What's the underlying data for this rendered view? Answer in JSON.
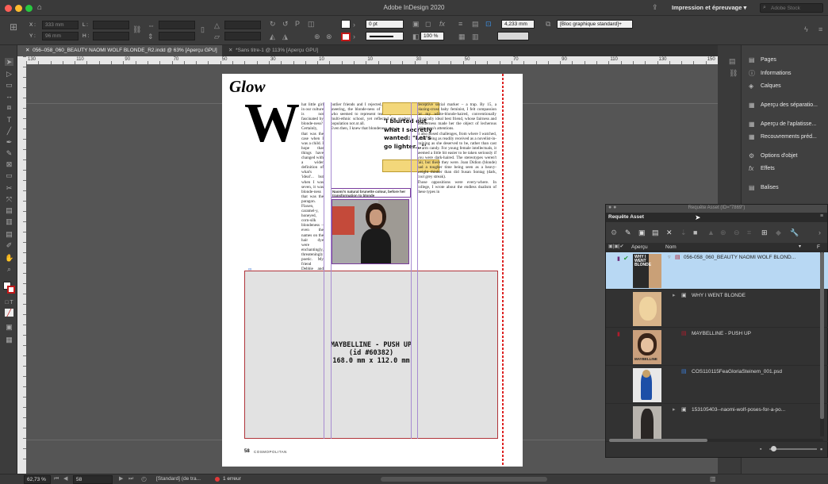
{
  "window": {
    "title": "Adobe InDesign 2020",
    "workspace": "Impression et épreuvage",
    "search_placeholder": "Adobe Stock"
  },
  "control": {
    "x_label": "X :",
    "y_label": "Y :",
    "w_label": "L :",
    "h_label": "H :",
    "x_value": "333 mm",
    "y_value": "96 mm",
    "stroke_weight": "0 pt",
    "scale": "100 %",
    "width_value": "4,233 mm",
    "object_style": "[Bloc graphique standard]+"
  },
  "tabs": [
    {
      "label": "056–058_060_BEAUTY NAOMI WOLF BLONDE_R2.indd @ 63% [Aperçu GPU]",
      "active": true
    },
    {
      "label": "*Sans titre-1 @ 113% [Aperçu GPU]",
      "active": false
    }
  ],
  "ruler_ticks": [
    "130",
    "120",
    "110",
    "100",
    "90",
    "80",
    "70",
    "60",
    "50",
    "40",
    "30",
    "20",
    "10",
    "0",
    "10",
    "20",
    "30",
    "40",
    "50",
    "60",
    "70",
    "80",
    "90",
    "100",
    "110",
    "120",
    "130",
    "140",
    "150",
    "160",
    "170",
    "180",
    "190",
    "200",
    "210",
    "220",
    "230",
    "240",
    "250",
    "260",
    "270",
    "280",
    "290",
    "300",
    "310",
    "320",
    "330",
    "340",
    "350",
    "360",
    "370",
    "380",
    "390",
    "400",
    "410",
    "420",
    "430"
  ],
  "document": {
    "logo": "Glow",
    "dropcap": "W",
    "col1": "hat little girl in our culture is not fascinated by blonde-ness? Certainly, that was the case when I was a child. I hope that things have changed with a wider definition of what's 'ideal'... but when I was seven, it was blonde-ness that was the paragon. Flaxen, caramel-y, honeyed, corn-silk blondeness – even the names on the hair dye were enchantingly, threateningly poetic. My friend Debbie and I, two dark-haired Jewish girls, would play with the gilt-topped Barbie, with her perky conical breasts, her vinyl house full of changes of clothing, her pink convertible. That was the life blondes led when I was a child.\n   The spell broke early. By the time I was 13, I was at ease with being a dark-haired, intellectual 'other'. My",
    "col2": "outlier friends and I rejected, to the point of sneering, the blonde-ness of the cheerleaders who seemed to represent team spirit in our multi-ethnic school, yet reflected the student population not at all.\n   Even then, I knew that blondeness was a",
    "caption": "Naomi's natural brunette colour, before her transformation to blonde",
    "pullquote": "'I blurted out what I secretly wanted: \"Let's go lighter...\"'",
    "col4": "deceptive social marker – a trap. By 15, a blazing-cross baby feminist, I felt compassion for my white-blonde-haired, conventionally physically ideal best friend, whose fairness and slenderness made her the object of lecherous older men's attentions.\n   It also posed challenges, from where I watched, to her being as readily received as a novelist-in-training as she deserved to be, rather than cast as arm candy. For young female intellectuals, it seemed a little bit easier to be taken seriously if you were dark-haired. The stereotypes weren't fair, but there they were. Joan Didion (blonde) had a tougher time being seen as a heavy-weight thinker than did Susan Sontag (dark, cool grey streak).\n   Those oppositions were every-where. In college, I wrote about the endless dualism of these types in",
    "placeholder_line1": "MAYBELLINE - PUSH UP",
    "placeholder_line2": "(id #60382)",
    "placeholder_line3": "168.0 mm x 112.0 mm",
    "folio_number": "58",
    "folio_text": "COSMOPOLITAN"
  },
  "panels": [
    {
      "label": "Pages",
      "icon": "pages-icon"
    },
    {
      "label": "Informations",
      "icon": "info-icon"
    },
    {
      "label": "Calques",
      "icon": "layers-icon"
    },
    {
      "label": "Aperçu des séparatio...",
      "icon": "separations-icon"
    },
    {
      "label": "Aperçu de l'aplatisse...",
      "icon": "flattener-icon"
    },
    {
      "label": "Recouvrements préd...",
      "icon": "trap-icon"
    },
    {
      "label": "Options d'objet",
      "icon": "object-options-icon"
    },
    {
      "label": "Effets",
      "icon": "fx-icon"
    },
    {
      "label": "Balises",
      "icon": "tags-icon"
    }
  ],
  "asset_panel": {
    "window_title": "Requête Asset (ID=\"7869\")",
    "tab": "Requête Asset",
    "col_preview": "Aperçu",
    "col_name": "Nom",
    "col_f": "F",
    "rows": [
      {
        "name": "056-058_060_BEAUTY NAOMI WOLF BLOND...",
        "thumb_text": "WHY I WENT BLONDE",
        "selected": true
      },
      {
        "name": "WHY I WENT BLONDE",
        "thumb_text": "",
        "selected": false
      },
      {
        "name": "MAYBELLINE - PUSH UP",
        "thumb_text": "MAYBELLINE",
        "selected": false
      },
      {
        "name": "COS110115FeaGloriaSteinem_001.psd",
        "thumb_text": "",
        "selected": false
      },
      {
        "name": "153105403--naomi-wolf-poses-for-a-po...",
        "thumb_text": "",
        "selected": false
      }
    ]
  },
  "status": {
    "zoom": "62,73 %",
    "page": "58",
    "style": "[Standard] (de tra...",
    "errors": "1 erreur"
  }
}
